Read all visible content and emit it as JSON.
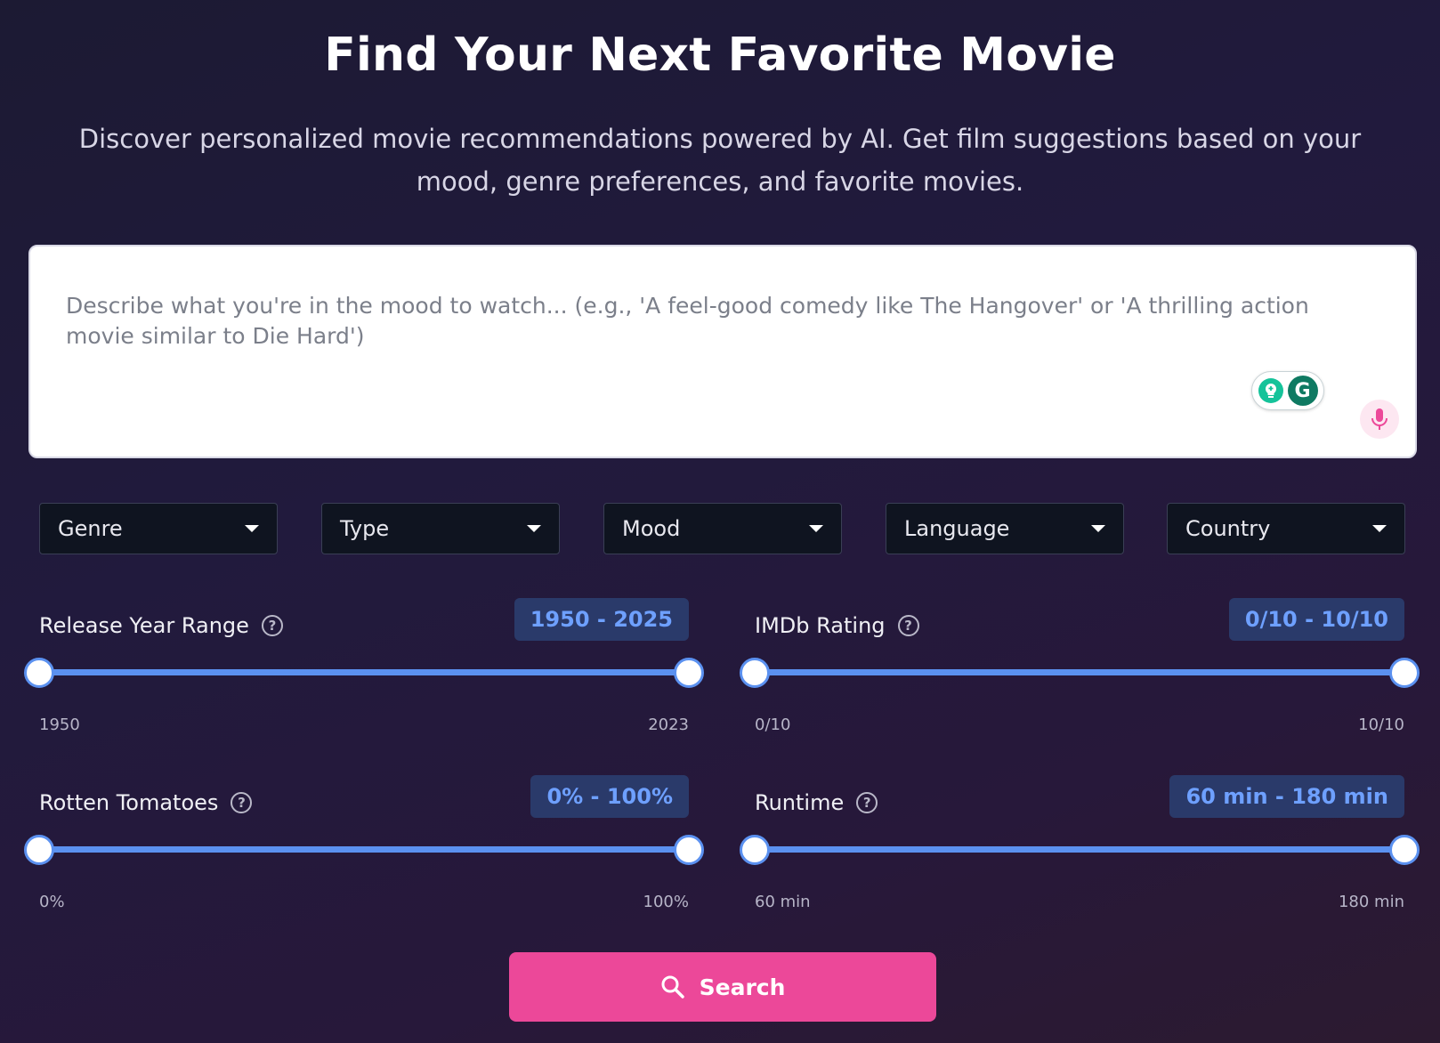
{
  "header": {
    "title": "Find Your Next Favorite Movie",
    "subtitle": "Discover personalized movie recommendations powered by AI. Get film suggestions based on your mood, genre preferences, and favorite movies."
  },
  "prompt": {
    "placeholder": "Describe what you're in the mood to watch... (e.g., 'A feel-good comedy like The Hangover' or 'A thrilling action movie similar to Die Hard')",
    "value": "",
    "grammarly_letter": "G"
  },
  "filters": [
    {
      "label": "Genre"
    },
    {
      "label": "Type"
    },
    {
      "label": "Mood"
    },
    {
      "label": "Language"
    },
    {
      "label": "Country"
    }
  ],
  "sliders": {
    "release_year": {
      "label": "Release Year Range",
      "badge": "1950 - 2025",
      "min_label": "1950",
      "max_label": "2023",
      "low_fraction": 0,
      "high_fraction": 1
    },
    "imdb": {
      "label": "IMDb Rating",
      "badge": "0/10 - 10/10",
      "min_label": "0/10",
      "max_label": "10/10",
      "low_fraction": 0,
      "high_fraction": 1
    },
    "rotten": {
      "label": "Rotten Tomatoes",
      "badge": "0% - 100%",
      "min_label": "0%",
      "max_label": "100%",
      "low_fraction": 0,
      "high_fraction": 1
    },
    "runtime": {
      "label": "Runtime",
      "badge": "60 min - 180 min",
      "min_label": "60 min",
      "max_label": "180 min",
      "low_fraction": 0,
      "high_fraction": 1
    }
  },
  "search_button": {
    "label": "Search"
  },
  "help_glyph": "?",
  "colors": {
    "accent": "#ec4899",
    "slider": "#5b91f0",
    "badge_text": "#6ea0ff"
  }
}
